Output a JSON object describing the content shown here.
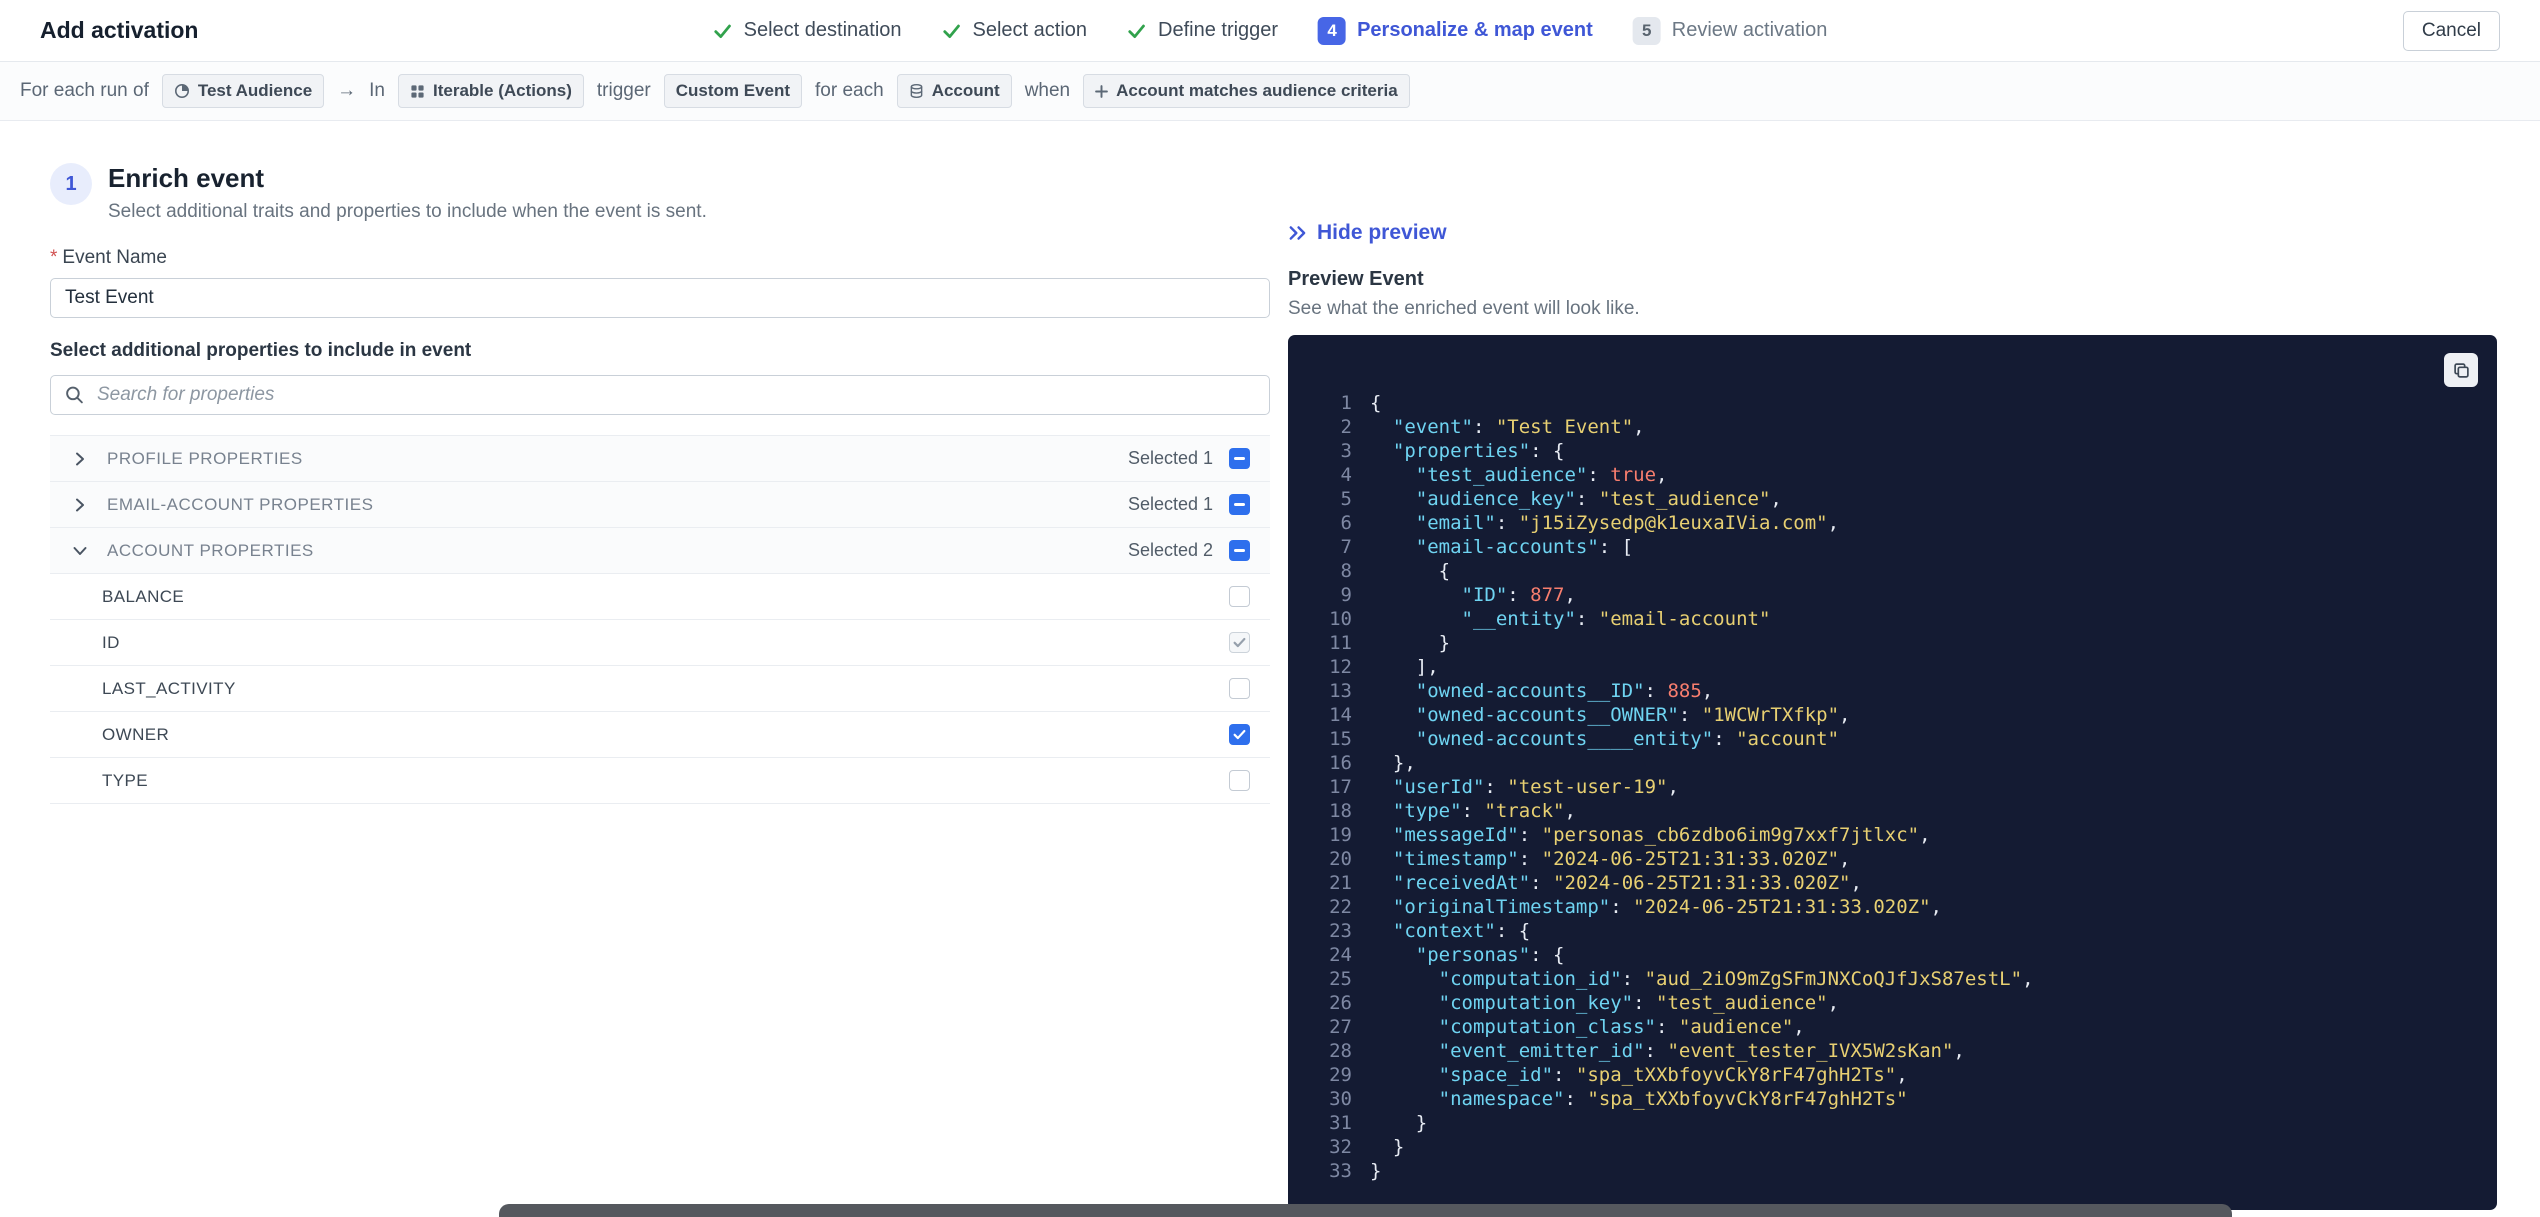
{
  "header": {
    "title": "Add activation",
    "cancel_label": "Cancel"
  },
  "stepper": {
    "steps": [
      {
        "label": "Select destination",
        "state": "done"
      },
      {
        "label": "Select action",
        "state": "done"
      },
      {
        "label": "Define trigger",
        "state": "done"
      },
      {
        "label": "Personalize & map event",
        "state": "active",
        "number": "4"
      },
      {
        "label": "Review activation",
        "state": "upcoming",
        "number": "5"
      }
    ]
  },
  "trigger_bar": {
    "segments": [
      {
        "type": "text",
        "text": "For each run of"
      },
      {
        "type": "chip",
        "text": "Test Audience",
        "icon": "audience-icon"
      },
      {
        "type": "text",
        "text": "→"
      },
      {
        "type": "text",
        "text": "In"
      },
      {
        "type": "chip",
        "text": "Iterable (Actions)",
        "icon": "destination-icon"
      },
      {
        "type": "text",
        "text": "trigger"
      },
      {
        "type": "chip",
        "text": "Custom Event"
      },
      {
        "type": "text",
        "text": "for each"
      },
      {
        "type": "chip",
        "text": "Account",
        "icon": "entity-icon"
      },
      {
        "type": "text",
        "text": "when"
      },
      {
        "type": "chip",
        "text": "Account matches audience criteria",
        "icon": "plus-icon"
      }
    ]
  },
  "enrich": {
    "step_number": "1",
    "title": "Enrich event",
    "subtitle": "Select additional traits and properties to include when the event is sent.",
    "event_name": {
      "required_mark": "*",
      "label": "Event Name",
      "value": "Test Event"
    },
    "properties_label": "Select additional properties to include in event",
    "search_placeholder": "Search for properties",
    "groups": [
      {
        "label": "PROFILE PROPERTIES",
        "selected_text": "Selected 1",
        "expanded": false,
        "checkbox": "indeterminate",
        "items": []
      },
      {
        "label": "EMAIL-ACCOUNT PROPERTIES",
        "selected_text": "Selected 1",
        "expanded": false,
        "checkbox": "indeterminate",
        "items": []
      },
      {
        "label": "ACCOUNT PROPERTIES",
        "selected_text": "Selected 2",
        "expanded": true,
        "checkbox": "indeterminate",
        "items": [
          {
            "label": "BALANCE",
            "checkbox": "unchecked"
          },
          {
            "label": "ID",
            "checkbox": "checked-disabled"
          },
          {
            "label": "LAST_ACTIVITY",
            "checkbox": "unchecked"
          },
          {
            "label": "OWNER",
            "checkbox": "checked"
          },
          {
            "label": "TYPE",
            "checkbox": "unchecked"
          }
        ]
      }
    ]
  },
  "preview": {
    "hide_label": "Hide preview",
    "title": "Preview Event",
    "subtitle": "See what the enriched event will look like.",
    "code_lines": [
      "{",
      "  \"event\": \"Test Event\",",
      "  \"properties\": {",
      "    \"test_audience\": true,",
      "    \"audience_key\": \"test_audience\",",
      "    \"email\": \"j15iZysedp@k1euxaIVia.com\",",
      "    \"email-accounts\": [",
      "      {",
      "        \"ID\": 877,",
      "        \"__entity\": \"email-account\"",
      "      }",
      "    ],",
      "    \"owned-accounts__ID\": 885,",
      "    \"owned-accounts__OWNER\": \"1WCWrTXfkp\",",
      "    \"owned-accounts____entity\": \"account\"",
      "  },",
      "  \"userId\": \"test-user-19\",",
      "  \"type\": \"track\",",
      "  \"messageId\": \"personas_cb6zdbo6im9g7xxf7jtlxc\",",
      "  \"timestamp\": \"2024-06-25T21:31:33.020Z\",",
      "  \"receivedAt\": \"2024-06-25T21:31:33.020Z\",",
      "  \"originalTimestamp\": \"2024-06-25T21:31:33.020Z\",",
      "  \"context\": {",
      "    \"personas\": {",
      "      \"computation_id\": \"aud_2iO9mZgSFmJNXCoQJfJxS87estL\",",
      "      \"computation_key\": \"test_audience\",",
      "      \"computation_class\": \"audience\",",
      "      \"event_emitter_id\": \"event_tester_IVX5W2sKan\",",
      "      \"space_id\": \"spa_tXXbfoyvCkY8rF47ghH2Ts\",",
      "      \"namespace\": \"spa_tXXbfoyvCkY8rF47ghH2Ts\"",
      "    }",
      "  }",
      "}"
    ]
  },
  "colors": {
    "accent": "#3f57d6",
    "active_badge": "#4766e6",
    "checkbox_blue": "#2e6fed",
    "success_green": "#31a24c",
    "code_bg": "#141b33",
    "tok_key": "#6fd4f2",
    "tok_str": "#e8d072",
    "tok_num": "#f87e6e",
    "line_no": "#7e88a3",
    "required_red": "#d15151",
    "bottom_strip": "#55585e"
  }
}
